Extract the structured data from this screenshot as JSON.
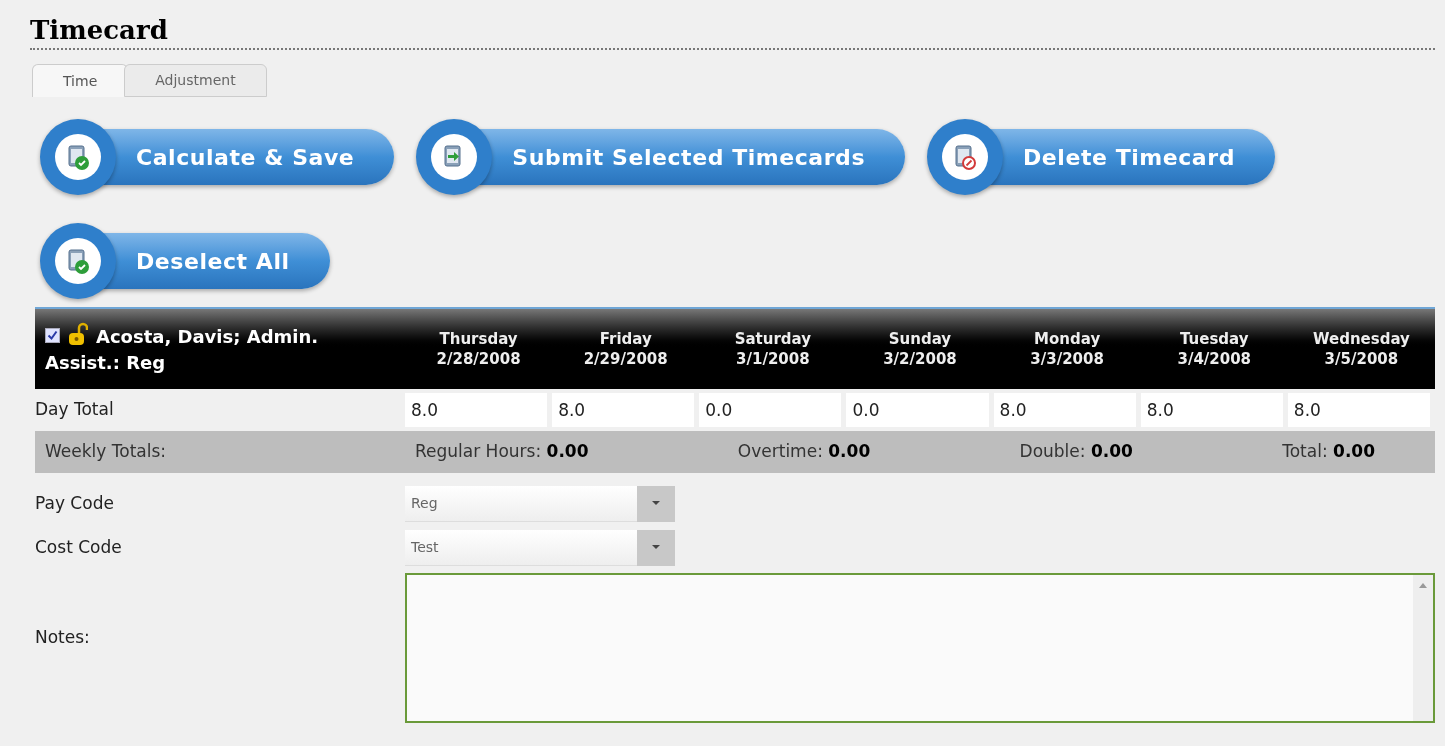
{
  "title": "Timecard",
  "tabs": [
    {
      "label": "Time",
      "selected": true
    },
    {
      "label": "Adjustment",
      "selected": false
    }
  ],
  "buttons": [
    {
      "label": "Calculate & Save",
      "kind": "check"
    },
    {
      "label": "Submit Selected Timecards",
      "kind": "arrow"
    },
    {
      "label": "Delete Timecard",
      "kind": "delete"
    },
    {
      "label": "Deselect All",
      "kind": "check"
    }
  ],
  "employee": {
    "checked": true,
    "name_lines": [
      "Acosta, Davis; Admin.",
      "Assist.: Reg"
    ]
  },
  "days": [
    {
      "day": "Thursday",
      "date": "2/28/2008",
      "total": "8.0"
    },
    {
      "day": "Friday",
      "date": "2/29/2008",
      "total": "8.0"
    },
    {
      "day": "Saturday",
      "date": "3/1/2008",
      "total": "0.0"
    },
    {
      "day": "Sunday",
      "date": "3/2/2008",
      "total": "0.0"
    },
    {
      "day": "Monday",
      "date": "3/3/2008",
      "total": "8.0"
    },
    {
      "day": "Tuesday",
      "date": "3/4/2008",
      "total": "8.0"
    },
    {
      "day": "Wednesday",
      "date": "3/5/2008",
      "total": "8.0"
    }
  ],
  "day_total_label": "Day Total",
  "weekly": {
    "label": "Weekly Totals:",
    "items": [
      {
        "label": "Regular Hours:",
        "value": "0.00"
      },
      {
        "label": "Overtime:",
        "value": "0.00"
      },
      {
        "label": "Double:",
        "value": "0.00"
      },
      {
        "label": "Total:",
        "value": "0.00"
      }
    ]
  },
  "fields": [
    {
      "label": "Pay Code",
      "value": "Reg"
    },
    {
      "label": "Cost Code",
      "value": "Test"
    }
  ],
  "notes": {
    "label": "Notes:"
  }
}
